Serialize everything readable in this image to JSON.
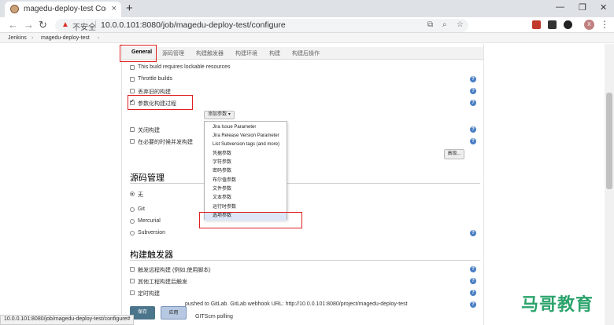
{
  "browser": {
    "tab_title": "magedu-deploy-test Config [Je",
    "tab_close": "×",
    "new_tab": "+",
    "minimize": "—",
    "restore": "❐",
    "close": "✕",
    "insecure_label": "不安全",
    "url": "10.0.0.101:8080/job/magedu-deploy-test/configure",
    "avatar_letter": "X",
    "status_url": "10.0.0.101:8080/job/magedu-deploy-test/configure#"
  },
  "breadcrumb": {
    "items": [
      "Jenkins",
      "›",
      "magedu-deploy-test",
      "›"
    ]
  },
  "config_tabs": [
    "General",
    "源码管理",
    "构建触发器",
    "构建环境",
    "构建",
    "构建后操作"
  ],
  "general": {
    "options": [
      {
        "label": "This build requires lockable resources",
        "checked": false
      },
      {
        "label": "Throttle builds",
        "checked": false
      },
      {
        "label": "丢弃旧的构建",
        "checked": false
      },
      {
        "label": "参数化构建过程",
        "checked": true
      },
      {
        "label": "关闭构建",
        "checked": false
      },
      {
        "label": "在必要的时候并发构建",
        "checked": false
      }
    ],
    "add_param_button": "添加参数",
    "advanced_button": "高级..."
  },
  "param_menu": {
    "items": [
      "Jira Issue Parameter",
      "Jira Release Version Parameter",
      "List Subversion tags (and more)",
      "凭据参数",
      "字符参数",
      "密码参数",
      "布尔值参数",
      "文件参数",
      "文本参数",
      "运行时参数",
      "选项参数"
    ],
    "highlighted_index": 10
  },
  "scm": {
    "title": "源码管理",
    "options": [
      {
        "label": "无",
        "checked": true
      },
      {
        "label": "Git",
        "checked": false
      },
      {
        "label": "Mercurial",
        "checked": false
      },
      {
        "label": "Subversion",
        "checked": false
      }
    ]
  },
  "triggers": {
    "title": "构建触发器",
    "options": [
      {
        "label": "触发远程构建 (例如,使用脚本)",
        "checked": false
      },
      {
        "label": "其他工程构建后触发",
        "checked": false
      },
      {
        "label": "定时构建",
        "checked": false
      },
      {
        "label": "pushed to GitLab. GitLab webhook URL: http://10.0.0.101:8080/project/magedu-deploy-test",
        "checked": false
      },
      {
        "label": "GITScm polling",
        "checked": false
      }
    ]
  },
  "footer": {
    "save_button": "保存",
    "apply_button": "应用"
  },
  "watermark": "马哥教育",
  "help_icon": "?",
  "colors": {
    "accent_red": "#e02020",
    "save_blue": "#4b758b",
    "help_blue": "#4a7fc4",
    "watermark_green": "#2aa36b"
  }
}
